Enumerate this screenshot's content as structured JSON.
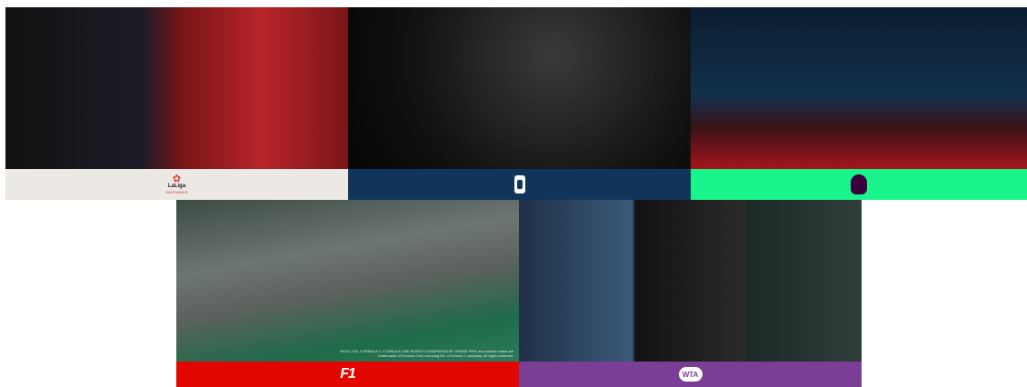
{
  "tiles": [
    {
      "id": "laliga",
      "logo_word": "LaLiga",
      "logo_sub": "SANTANDER",
      "band_color": "#ece9e4"
    },
    {
      "id": "seriea",
      "band_color": "#11355a"
    },
    {
      "id": "premier_league",
      "band_color": "#19f58a"
    },
    {
      "id": "f1",
      "logo_text": "F1",
      "band_color": "#e10600",
      "fineprint": "RADO, FIA, FORMULA 1, FORMULA ONE WORLD CHAMPIONSHIP, GRAND PRIX and related marks are trademarks of Formula One Licensing BV, a Formula 1 company. All rights reserved."
    },
    {
      "id": "wta",
      "logo_text": "WTA",
      "band_color": "#7a3f95"
    }
  ]
}
